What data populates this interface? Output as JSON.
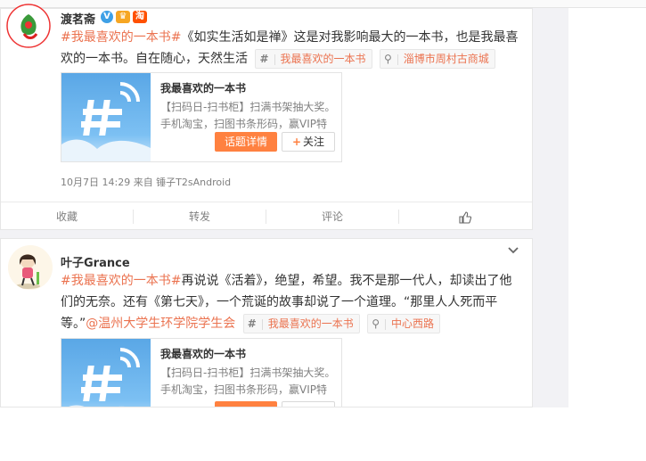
{
  "posts": [
    {
      "username": "渡茗斋",
      "badges": [
        "V",
        "👑",
        "淘"
      ],
      "text_parts": {
        "topic": "#我最喜欢的一本书#",
        "body": "《如实生活如是禅》这是对我影响最大的一本书，也是我最喜欢的一本书。自在随心，天然生活"
      },
      "topic_chip": "我最喜欢的一本书",
      "location_chip": "淄博市周村古商城",
      "card": {
        "title": "我最喜欢的一本书",
        "desc": "【扫码日-扫书柜】扫满书架抽大奖。手机淘宝，扫图书条形码，赢VIP特",
        "topic_button": "话题详情",
        "follow_button": "关注"
      },
      "meta": "10月7日 14:29 来自 锤子T2sAndroid",
      "actions": {
        "collect": "收藏",
        "repost": "转发",
        "comment": "评论"
      }
    },
    {
      "username": "叶子Grance",
      "text_parts": {
        "topic": "#我最喜欢的一本书#",
        "body": "再说说《活着》，绝望，希望。我不是那一代人，却读出了他们的无奈。还有《第七天》，一个荒诞的故事却说了一个道理。“那里人人死而平等。”",
        "mention": "@温州大学生环学院学生会"
      },
      "topic_chip": "我最喜欢的一本书",
      "location_chip": "中心西路",
      "card": {
        "title": "我最喜欢的一本书",
        "desc": "【扫码日-扫书柜】扫满书架抽大奖。手机淘宝，扫图书条形码，赢VIP特"
      }
    }
  ],
  "colors": {
    "accent": "#eb7350",
    "button": "#ff8140",
    "page_bg": "#f2f2f5"
  }
}
